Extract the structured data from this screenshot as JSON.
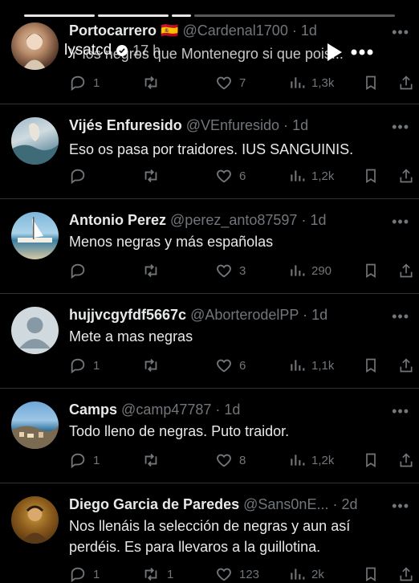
{
  "story": {
    "username": "lysatcd",
    "time": "17 h",
    "progress_segments": [
      true,
      true,
      false,
      false
    ],
    "controls": [
      "play-icon",
      "more-icon"
    ]
  },
  "tweets": [
    {
      "name": "Portocarrero 🇪🇸",
      "handle": "@Cardenal1700",
      "time": "1d",
      "text": "Y los negros que Montenegro si que pois...",
      "replies": "1",
      "retweets": "",
      "likes": "7",
      "views": "1,3k"
    },
    {
      "name": "Vijés Enfuresido",
      "handle": "@VEnfuresido",
      "time": "1d",
      "text": "Eso os pasa por traidores. IUS SANGUINIS.",
      "replies": "",
      "retweets": "",
      "likes": "6",
      "views": "1,2k"
    },
    {
      "name": "Antonio Perez",
      "handle": "@perez_anto87597",
      "time": "1d",
      "text": "Menos negras y más españolas",
      "replies": "",
      "retweets": "",
      "likes": "3",
      "views": "290"
    },
    {
      "name": "hujjvcgyfdf5667c",
      "handle": "@AborterodelPP",
      "time": "1d",
      "text": "Mete a mas negras",
      "replies": "1",
      "retweets": "",
      "likes": "6",
      "views": "1,1k"
    },
    {
      "name": "Camps",
      "handle": "@camp47787",
      "time": "1d",
      "text": "Todo lleno de negras. Puto traidor.",
      "replies": "1",
      "retweets": "",
      "likes": "8",
      "views": "1,2k"
    },
    {
      "name": "Diego Garcia de Paredes",
      "handle": "@Sans0nE...",
      "time": "2d",
      "text": "Nos llenáis la selección de negras y aun así perdéis. Es para llevaros a la guillotina.",
      "replies": "1",
      "retweets": "1",
      "likes": "123",
      "views": "2k"
    }
  ],
  "separator": "·",
  "more_label": "•••",
  "colors": {
    "background": "#000000",
    "text": "#e7e9ea",
    "muted": "#71767b",
    "divider": "#2f3336"
  }
}
